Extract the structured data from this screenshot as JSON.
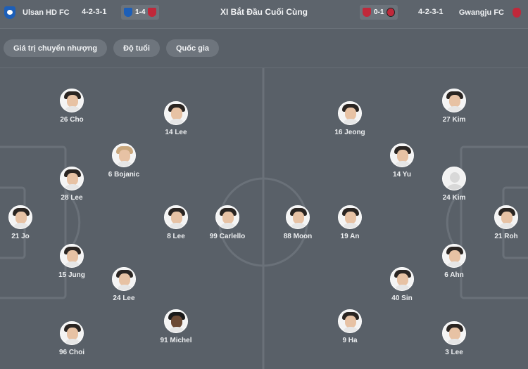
{
  "header": {
    "title": "XI Bắt Đầu Cuối Cùng",
    "home": {
      "name": "Ulsan HD FC",
      "formation": "4-2-3-1",
      "recent_score": "1-4",
      "crest_icon": "ulsan-crest-icon"
    },
    "away": {
      "name": "Gwangju FC",
      "formation": "4-2-3-1",
      "recent_score": "0-1",
      "crest_icon": "gwangju-crest-icon"
    }
  },
  "filters": [
    "Giá trị chuyển nhượng",
    "Độ tuổi",
    "Quốc gia"
  ],
  "home_players": [
    {
      "label": "21 Jo",
      "face": "light"
    },
    {
      "label": "26 Cho",
      "face": "light"
    },
    {
      "label": "28 Lee",
      "face": "light"
    },
    {
      "label": "15 Jung",
      "face": "light"
    },
    {
      "label": "96 Choi",
      "face": "light"
    },
    {
      "label": "6 Bojanic",
      "face": "blond"
    },
    {
      "label": "24 Lee",
      "face": "light"
    },
    {
      "label": "14 Lee",
      "face": "light"
    },
    {
      "label": "8 Lee",
      "face": "light"
    },
    {
      "label": "91 Michel",
      "face": "dark"
    },
    {
      "label": "99 Carlello",
      "face": "light"
    }
  ],
  "away_players": [
    {
      "label": "21 Roh",
      "face": "light"
    },
    {
      "label": "27 Kim",
      "face": "light"
    },
    {
      "label": "24 Kim",
      "face": "blank"
    },
    {
      "label": "6 Ahn",
      "face": "light"
    },
    {
      "label": "3 Lee",
      "face": "light"
    },
    {
      "label": "14 Yu",
      "face": "light"
    },
    {
      "label": "40 Sin",
      "face": "light"
    },
    {
      "label": "16 Jeong",
      "face": "light"
    },
    {
      "label": "19 An",
      "face": "light"
    },
    {
      "label": "9 Ha",
      "face": "light"
    },
    {
      "label": "88 Moon",
      "face": "light"
    }
  ],
  "colors": {
    "background": "#596068",
    "chip": "#6e757d",
    "home_accent": "#1d5fb8",
    "away_accent": "#c0283a"
  }
}
